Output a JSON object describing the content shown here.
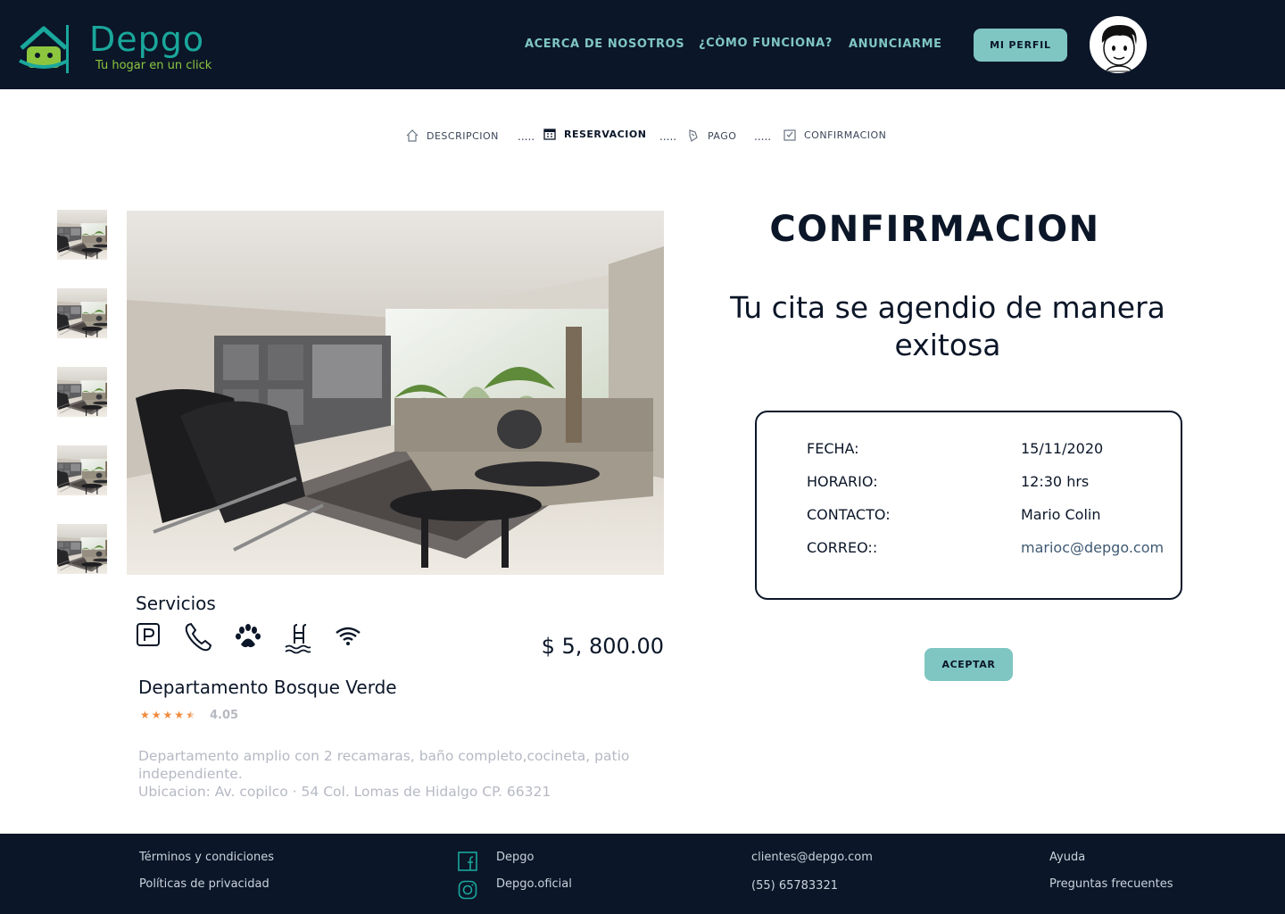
{
  "header": {
    "brand_name": "Depgo",
    "tagline": "Tu hogar en un click",
    "nav": [
      "ACERCA DE NOSOTROS",
      "¿CÒMO FUNCIONA?",
      "ANUNCIARME"
    ],
    "profile_button": "MI PERFIL"
  },
  "stepper": {
    "steps": [
      "DESCRIPCION",
      "RESERVACION",
      "PAGO",
      "CONFIRMACION"
    ],
    "separator": ".....",
    "active_step": "RESERVACION"
  },
  "property": {
    "services_title": "Servicios",
    "amenities": [
      "parking-icon",
      "phone-icon",
      "paw-icon",
      "pool-icon",
      "wifi-icon"
    ],
    "price": "$ 5, 800.00",
    "title": "Departamento Bosque Verde",
    "rating_value": "4.05",
    "stars": 4.5,
    "description": "Departamento amplio con 2 recamaras, baño completo,cocineta, patio independiente.",
    "location": "Ubicacion: Av. copilco · 54 Col. Lomas de Hidalgo CP. 66321"
  },
  "confirmation": {
    "title": "CONFIRMACION",
    "message": "Tu cita se agendio de manera exitosa",
    "rows": [
      {
        "label": "FECHA:",
        "value": "15/11/2020"
      },
      {
        "label": "HORARIO:",
        "value": "12:30 hrs"
      },
      {
        "label": "CONTACTO:",
        "value": "Mario Colin"
      },
      {
        "label": "CORREO::",
        "value": "marioc@depgo.com"
      }
    ],
    "accept_button": "ACEPTAR"
  },
  "footer": {
    "terms": "Términos y condiciones",
    "privacy": "Políticas  de privacidad",
    "facebook": "Depgo",
    "instagram": "Depgo.oficial",
    "email": "clientes@depgo.com",
    "phone": "(55) 65783321",
    "help": "Ayuda",
    "faq": "Preguntas frecuentes"
  },
  "colors": {
    "navy": "#0b1628",
    "teal": "#7fc6c2",
    "brand_teal": "#1aa79c",
    "brand_green": "#8cc63f",
    "star_orange": "#f08a3c"
  }
}
